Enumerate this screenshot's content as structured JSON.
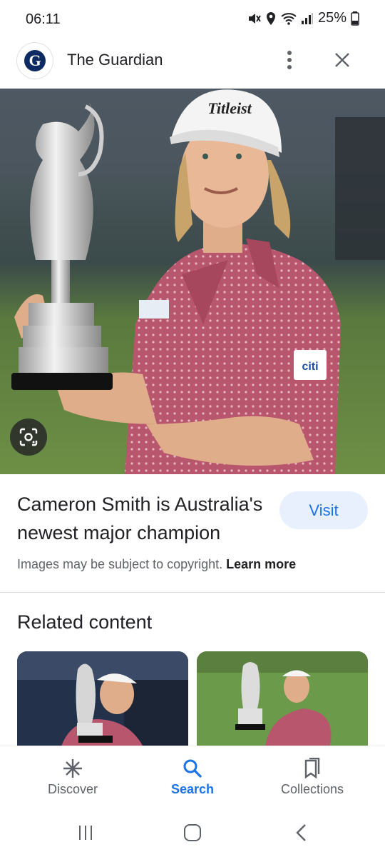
{
  "status_bar": {
    "time": "06:11",
    "battery": "25%"
  },
  "source": {
    "title": "The Guardian",
    "logo_letter": "G"
  },
  "image": {
    "description_icons": [
      "trophy",
      "golfer"
    ],
    "sponsor_text": "citi",
    "cap_text": "Titleist"
  },
  "caption": {
    "title": "Cameron Smith is Australia's newest major champion",
    "visit_label": "Visit",
    "copyright_text": "Images may be subject to copyright.",
    "learn_more": "Learn more"
  },
  "related": {
    "heading": "Related content"
  },
  "bottom_nav": [
    {
      "label": "Discover",
      "icon": "asterisk-icon",
      "active": false
    },
    {
      "label": "Search",
      "icon": "search-icon",
      "active": true
    },
    {
      "label": "Collections",
      "icon": "bookmarks-icon",
      "active": false
    }
  ],
  "colors": {
    "accent": "#1a73e8",
    "visit_bg": "#e8f0fe",
    "shirt": "#b8566e"
  }
}
